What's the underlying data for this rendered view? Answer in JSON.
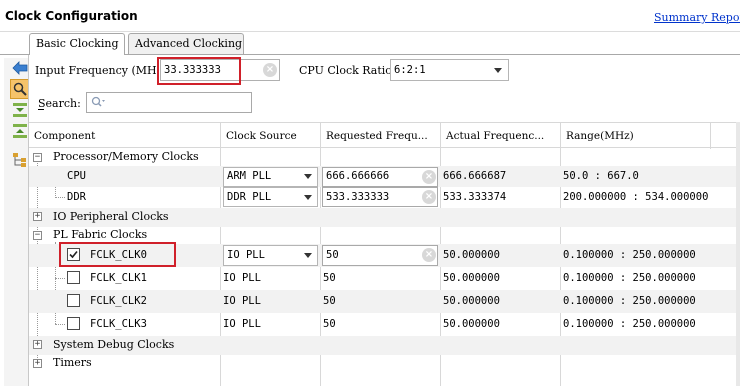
{
  "window": {
    "title": "Clock Configuration",
    "summary_link": "Summary Report"
  },
  "tabs": [
    {
      "label": "Basic Clocking",
      "active": true
    },
    {
      "label": "Advanced Clocking",
      "active": false
    }
  ],
  "toolbar": {
    "icons": [
      "back-arrow-icon",
      "search-icon",
      "collapse-all-icon",
      "expand-all-icon",
      "hierarchy-icon"
    ]
  },
  "input_frequency": {
    "label": "Input Frequency (MHz)",
    "value": "33.333333"
  },
  "cpu_clock_ratio": {
    "label": "CPU Clock Ratio",
    "value": "6:2:1"
  },
  "search": {
    "label": "Search:",
    "placeholder": "Q‑"
  },
  "columns": [
    "Component",
    "Clock Source",
    "Requested Frequ...",
    "Actual Frequenc...",
    "Range(MHz)"
  ],
  "tree": {
    "processor": {
      "label": "Processor/Memory Clocks",
      "rows": [
        {
          "name": "CPU",
          "source": "ARM PLL",
          "requested": "666.666666",
          "actual": "666.666687",
          "range": "50.0 : 667.0"
        },
        {
          "name": "DDR",
          "source": "DDR PLL",
          "requested": "533.333333",
          "actual": "533.333374",
          "range": "200.000000 : 534.000000"
        }
      ]
    },
    "io": {
      "label": "IO Peripheral Clocks"
    },
    "pl": {
      "label": "PL Fabric Clocks",
      "rows": [
        {
          "name": "FCLK_CLK0",
          "checked": true,
          "source": "IO PLL",
          "requested": "50",
          "actual": "50.000000",
          "range": "0.100000 : 250.000000"
        },
        {
          "name": "FCLK_CLK1",
          "checked": false,
          "source": "IO PLL",
          "requested": "50",
          "actual": "50.000000",
          "range": "0.100000 : 250.000000"
        },
        {
          "name": "FCLK_CLK2",
          "checked": false,
          "source": "IO PLL",
          "requested": "50",
          "actual": "50.000000",
          "range": "0.100000 : 250.000000"
        },
        {
          "name": "FCLK_CLK3",
          "checked": false,
          "source": "IO PLL",
          "requested": "50",
          "actual": "50.000000",
          "range": "0.100000 : 250.000000"
        }
      ]
    },
    "debug": {
      "label": "System Debug Clocks"
    },
    "timers": {
      "label": "Timers"
    }
  },
  "colors": {
    "highlight_red": "#d0202a",
    "link_blue": "#0033cc",
    "row_alt": "#f2f2f2"
  }
}
